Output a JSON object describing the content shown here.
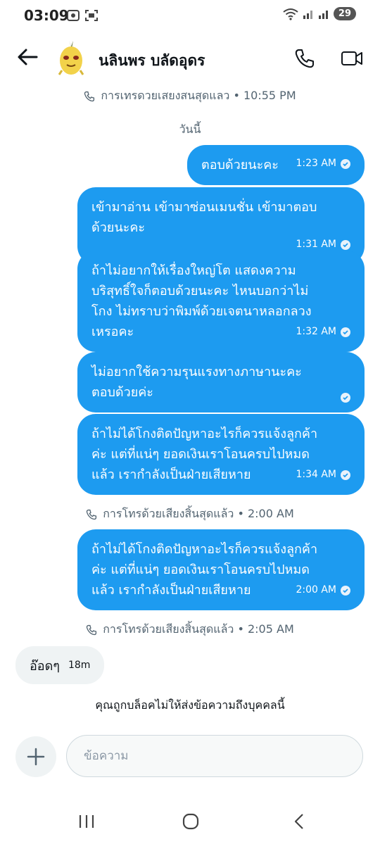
{
  "status_bar": {
    "time": "03:09",
    "battery": "29"
  },
  "header": {
    "title": "นลินพร บลัดอุดร"
  },
  "events": [
    {
      "text": "การเทรดวยเสยงสนสุดแลว • 10:55 PM"
    },
    {
      "text": "การโทรด้วยเสียงสิ้นสุดแล้ว • 2:00 AM"
    },
    {
      "text": "การโทรด้วยเสียงสิ้นสุดแล้ว • 2:05 AM"
    }
  ],
  "day_label": "วันนี้",
  "messages": [
    {
      "lines": [
        "ตอบด้วยนะคะ"
      ],
      "time": "1:23 AM"
    },
    {
      "lines": [
        "เข้ามาอ่าน เข้ามาซ่อนเมนชั่น เข้ามาตอบ",
        "ด้วยนะคะ"
      ],
      "time": "1:31 AM"
    },
    {
      "lines": [
        "ถ้าไม่อยากให้เรื่องใหญ่โต แสดงความ",
        "บริสุทธิ์ใจก็ตอบด้วยนะคะ ไหนบอกว่าไม่",
        "โกง ไม่ทราบว่าพิมพ์ด้วยเจตนาหลอกลวง",
        "เหรอคะ"
      ],
      "time": "1:32 AM"
    },
    {
      "lines": [
        "ไม่อยากใช้ความรุนแรงทางภาษานะคะ",
        "ตอบด้วยค่ะ"
      ],
      "time": ""
    },
    {
      "lines": [
        "ถ้าไม่ได้โกงติดปัญหาอะไรก็ควรแจ้งลูกค้า",
        "ค่ะ แต่ที่แน่ๆ ยอดเงินเราโอนครบไปหมด",
        "แล้ว เรากำลังเป็นฝ่ายเสียหาย"
      ],
      "time": "1:34 AM"
    },
    {
      "lines": [
        "ถ้าไม่ได้โกงติดปัญหาอะไรก็ควรแจ้งลูกค้า",
        "ค่ะ แต่ที่แน่ๆ ยอดเงินเราโอนครบไปหมด",
        "แล้ว เรากำลังเป็นฝ่ายเสียหาย"
      ],
      "time": "2:00 AM"
    }
  ],
  "incoming": {
    "text": "อ๊อดๆ",
    "time": "18m"
  },
  "blocked_notice": "คุณถูกบล็อคไม่ให้ส่งข้อความถึงบุคคลนี้",
  "composer": {
    "placeholder": "ข้อความ"
  },
  "colors": {
    "accent": "#1d9bf0",
    "incoming_bg": "#eff3f4",
    "muted": "#536471"
  },
  "icons": [
    "back-arrow-icon",
    "phone-icon",
    "video-icon",
    "check-circle-icon",
    "plus-icon",
    "recents-icon",
    "home-icon",
    "back-nav-icon"
  ]
}
